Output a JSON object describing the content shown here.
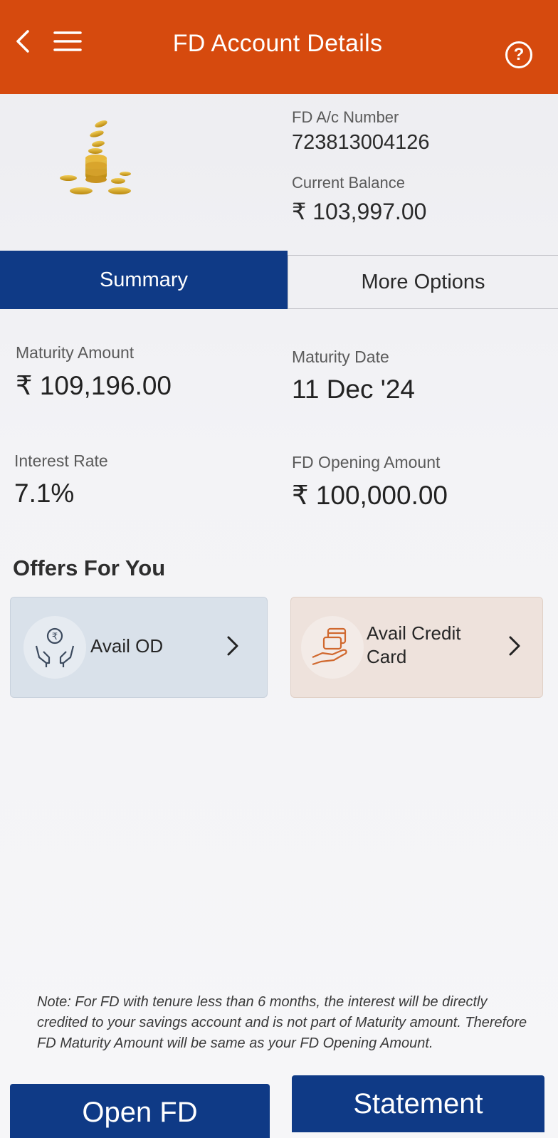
{
  "header": {
    "title": "FD Account Details",
    "help_symbol": "?",
    "color": "#d64a0e"
  },
  "account": {
    "number_label": "FD A/c Number",
    "number": "723813004126",
    "balance_label": "Current Balance",
    "balance": "₹ 103,997.00"
  },
  "tabs": {
    "summary": "Summary",
    "more_options": "More Options",
    "active": "Summary",
    "active_color": "#0f3a86"
  },
  "summary": {
    "maturity_amount_label": "Maturity Amount",
    "maturity_amount": "₹ 109,196.00",
    "maturity_date_label": "Maturity Date",
    "maturity_date": "11 Dec '24",
    "interest_rate_label": "Interest Rate",
    "interest_rate": "7.1%",
    "opening_amount_label": "FD Opening Amount",
    "opening_amount": "₹ 100,000.00"
  },
  "offers": {
    "title": "Offers For You",
    "items": [
      {
        "label": "Avail OD",
        "icon": "hands-rupee-icon"
      },
      {
        "label_line1": "Avail Credit",
        "label_line2": "Card",
        "icon": "hand-card-icon"
      }
    ]
  },
  "note": "Note: For FD with tenure less than 6 months, the interest will be directly credited to your savings account and is not part of Maturity amount. Therefore FD Maturity Amount will be same as your FD Opening Amount.",
  "buttons": {
    "open_fd": "Open FD",
    "statement": "Statement"
  }
}
